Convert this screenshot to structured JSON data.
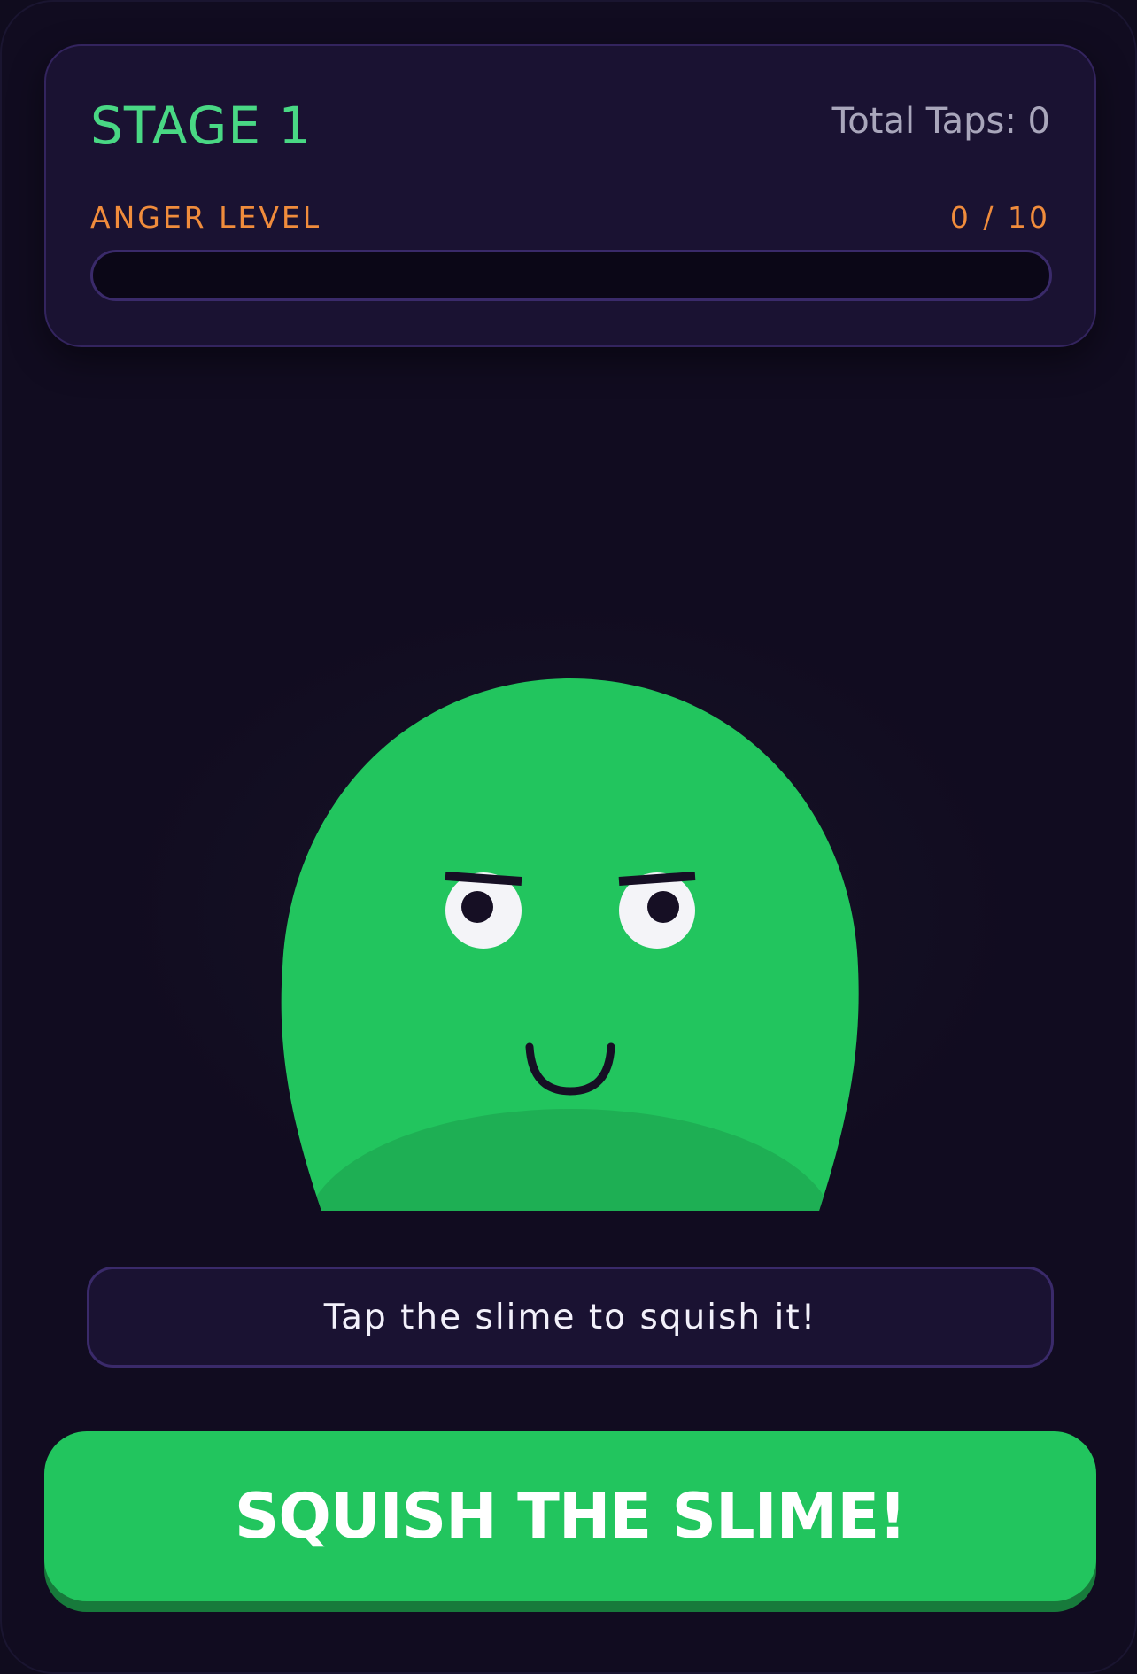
{
  "stats": {
    "stage_label": "STAGE 1",
    "total_taps_label": "Total Taps: 0",
    "anger": {
      "label": "ANGER LEVEL",
      "value_text": "0 / 10",
      "current": 0,
      "max": 10
    }
  },
  "message": {
    "text": "Tap the slime to squish it!"
  },
  "action": {
    "button_label": "SQUISH THE SLIME!"
  },
  "colors": {
    "background": "#110c20",
    "panel": "#1a1232",
    "panel_border": "#33245e",
    "stage_green": "#49d884",
    "anger_orange": "#f08c3c",
    "slime_green": "#22c55e",
    "slime_shadow": "#1eaf54",
    "button_green": "#22c55e",
    "button_shadow": "#177a3b"
  },
  "slime": {
    "expression": "smug-smile"
  }
}
